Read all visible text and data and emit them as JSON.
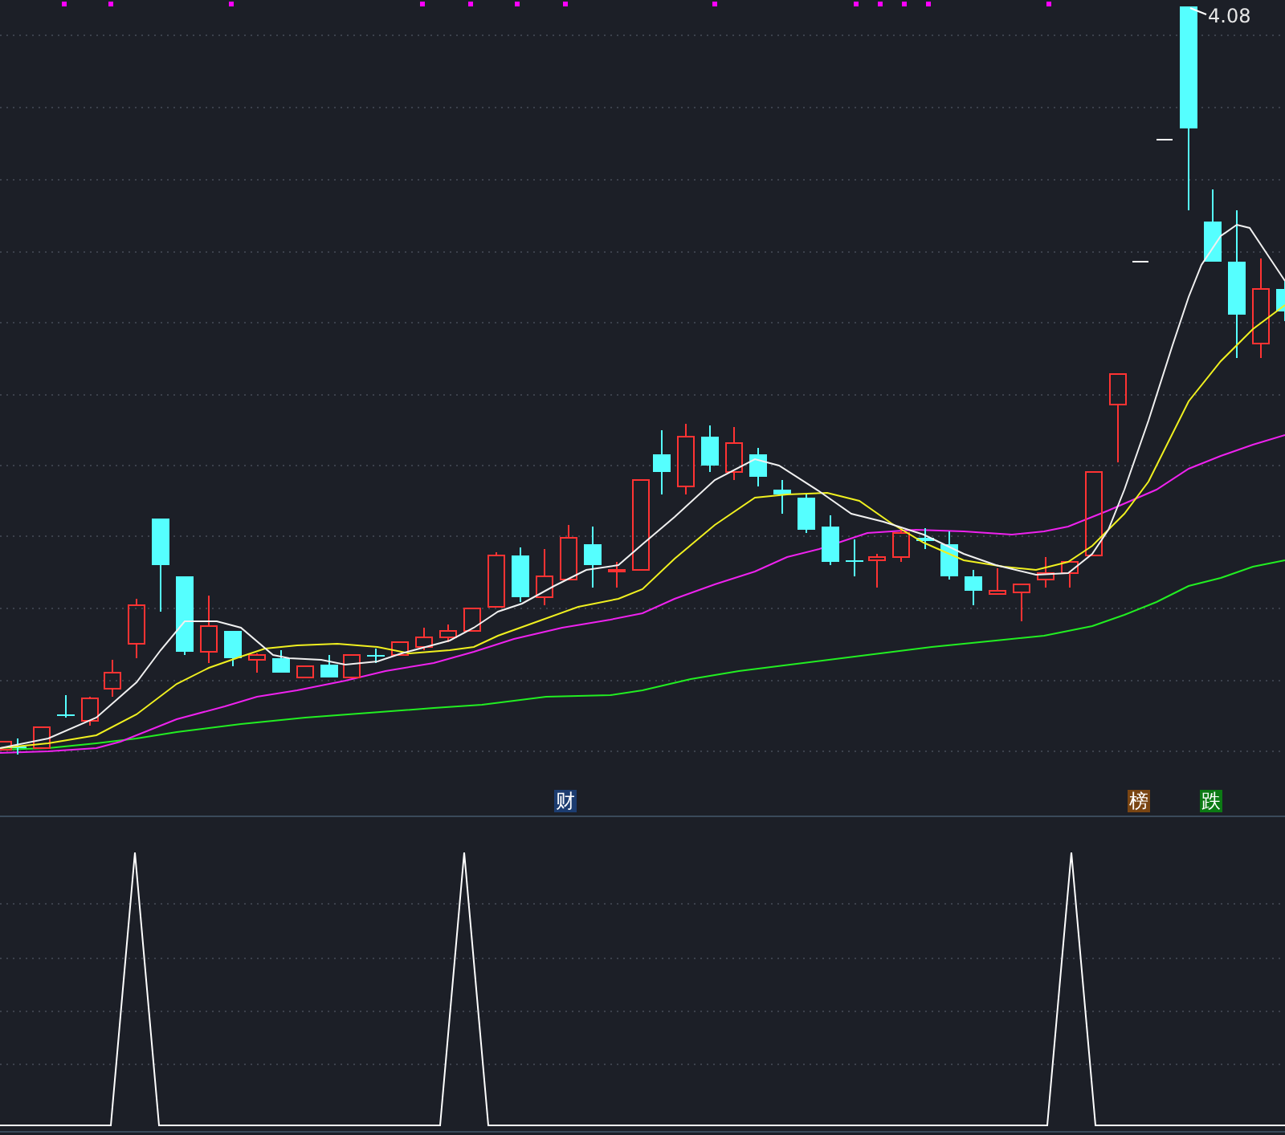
{
  "price_chart": {
    "high_label": "4.08",
    "event_badges": [
      {
        "text": "财",
        "color": "#1c3c70"
      },
      {
        "text": "榜",
        "color": "#7a4512"
      },
      {
        "text": "跌",
        "color": "#0c7a14"
      }
    ]
  }
}
